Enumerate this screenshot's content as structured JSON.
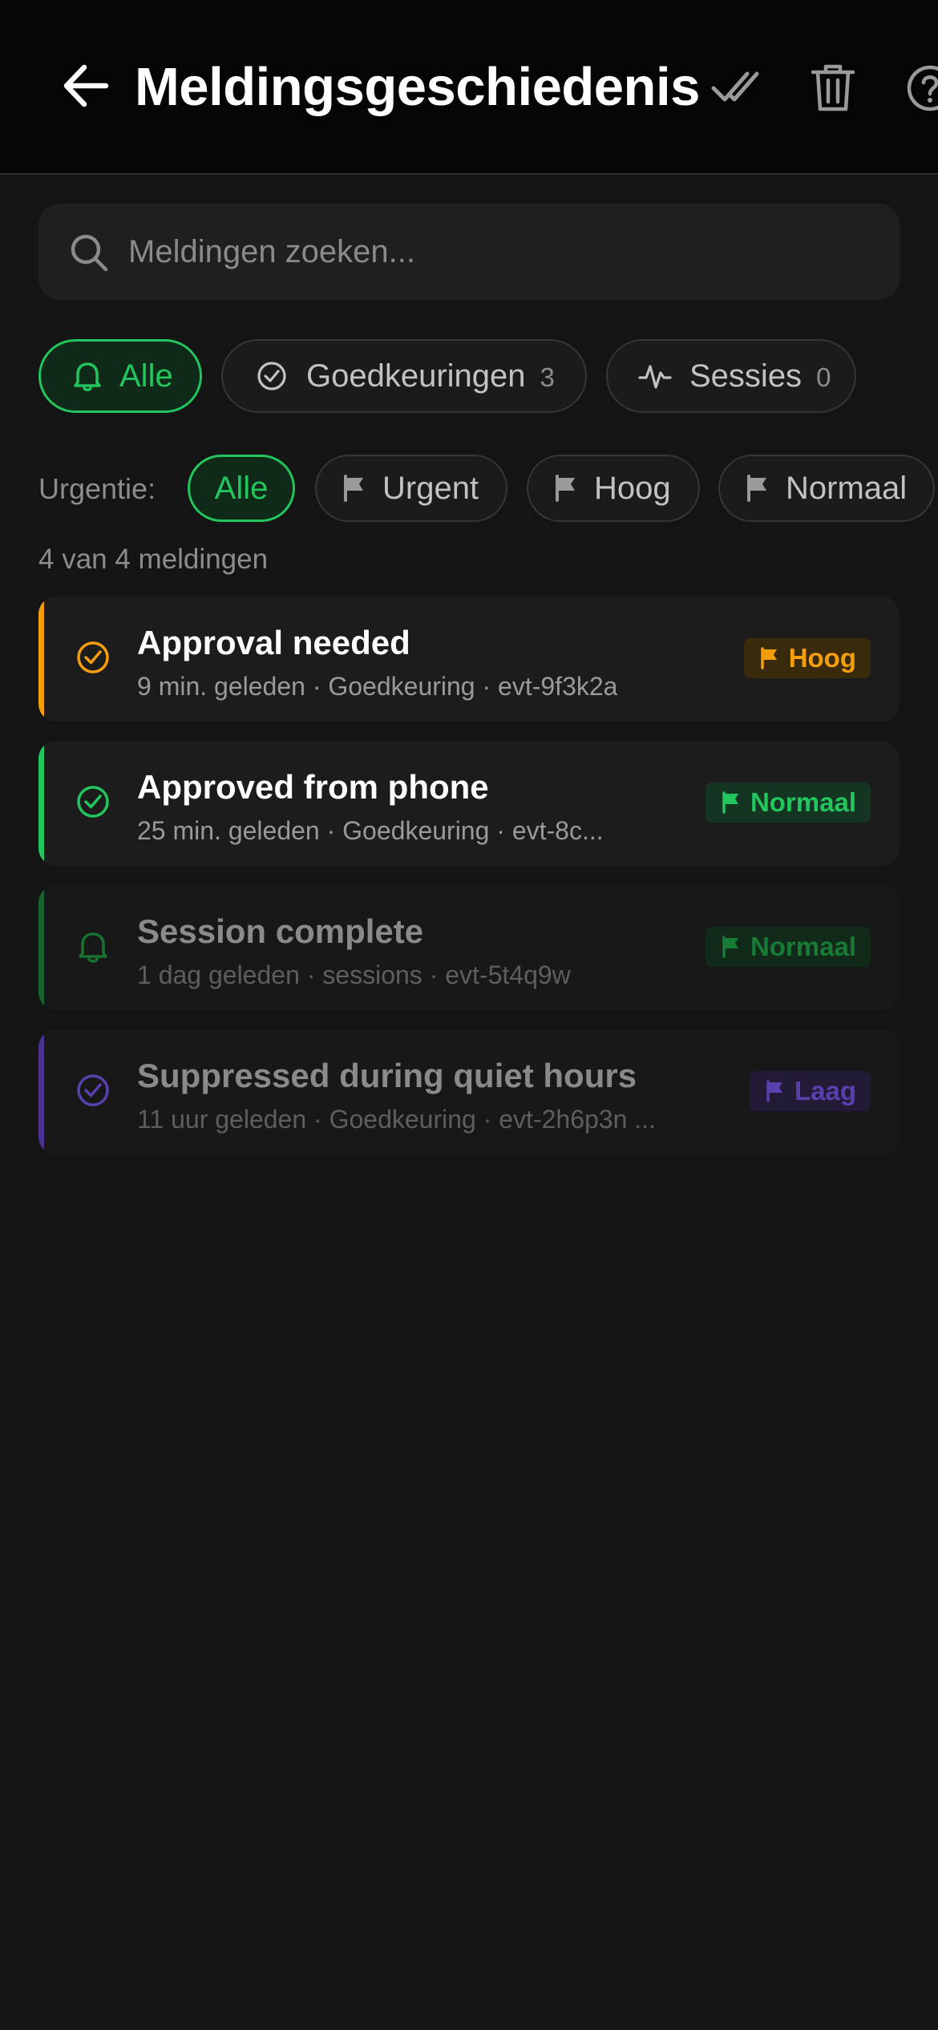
{
  "header": {
    "title": "Meldingsgeschiedenis",
    "back_icon": "arrow-left-icon",
    "actions": [
      "check-all-icon",
      "trash-icon",
      "help-icon"
    ]
  },
  "search": {
    "placeholder": "Meldingen zoeken...",
    "value": ""
  },
  "categories": [
    {
      "label": "Alle",
      "count": "",
      "icon": "bell-icon",
      "active": true
    },
    {
      "label": "Goedkeuringen",
      "count": "3",
      "icon": "check-circle-icon",
      "active": false
    },
    {
      "label": "Sessies",
      "count": "0",
      "icon": "activity-icon",
      "active": false
    }
  ],
  "urgency": {
    "label": "Urgentie:",
    "options": [
      {
        "label": "Alle",
        "active": true
      },
      {
        "label": "Urgent",
        "icon": "flag-icon"
      },
      {
        "label": "Hoog",
        "icon": "flag-icon"
      },
      {
        "label": "Normaal",
        "icon": "flag-icon"
      }
    ]
  },
  "result_count": "4 van 4 meldingen",
  "colors": {
    "accent_green": "#22c55e",
    "high_orange": "#f59e0b",
    "low_purple": "#6d4bc2",
    "background": "#141414"
  },
  "notifications": [
    {
      "title": "Approval needed",
      "meta": "9 min. geleden · Goedkeuring · evt-9f3k2a",
      "badge": "Hoog",
      "icon": "check-circle-icon",
      "read": false
    },
    {
      "title": "Approved from phone",
      "meta": "25 min. geleden · Goedkeuring · evt-8c...",
      "badge": "Normaal",
      "icon": "check-circle-icon",
      "read": false
    },
    {
      "title": "Session complete",
      "meta": "1 dag geleden · sessions · evt-5t4q9w",
      "badge": "Normaal",
      "icon": "bell-icon",
      "read": true
    },
    {
      "title": "Suppressed during quiet hours",
      "meta": "11 uur geleden · Goedkeuring · evt-2h6p3n ...",
      "badge": "Laag",
      "icon": "check-circle-icon",
      "read": true
    }
  ]
}
